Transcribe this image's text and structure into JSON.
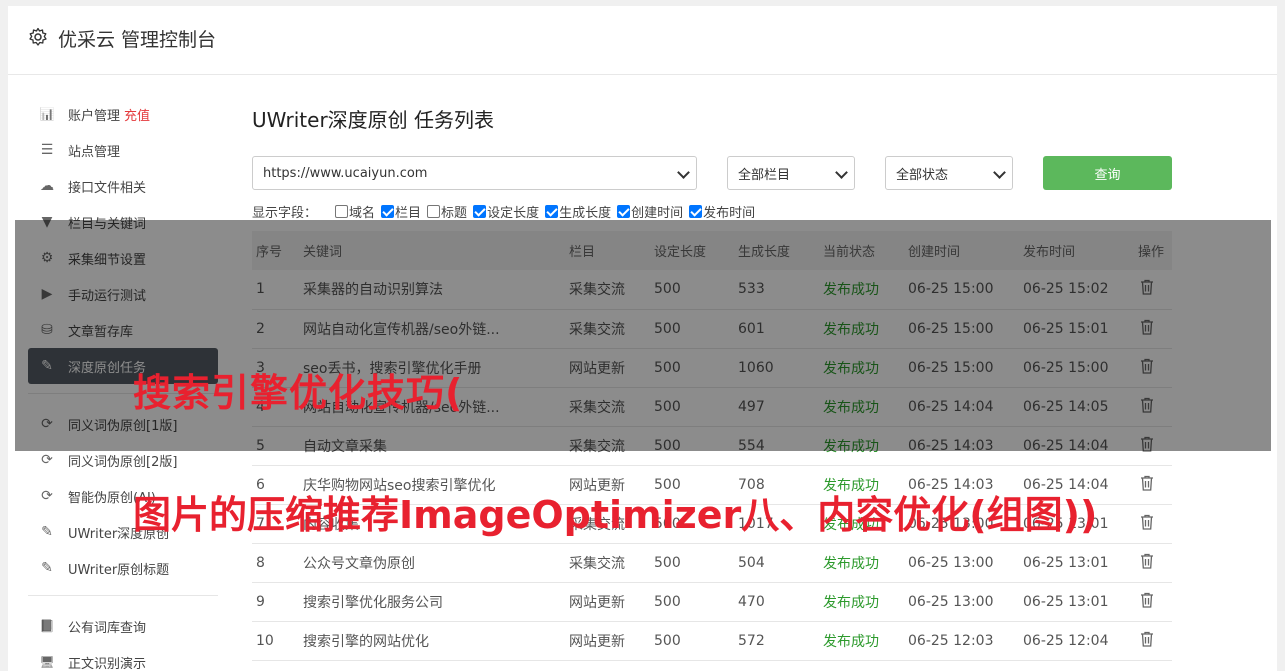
{
  "header": {
    "title": "优采云 管理控制台",
    "icon": "gear-icon"
  },
  "sidebar": {
    "charge_label": "充值",
    "group1": [
      {
        "label": "账户管理",
        "icon": "bar-chart-icon"
      },
      {
        "label": "站点管理",
        "icon": "server-icon"
      },
      {
        "label": "接口文件相关",
        "icon": "cloud-upload-icon"
      },
      {
        "label": "栏目与关键词",
        "icon": "filter-icon"
      },
      {
        "label": "采集细节设置",
        "icon": "cogs-icon"
      },
      {
        "label": "手动运行测试",
        "icon": "play-icon"
      },
      {
        "label": "文章暂存库",
        "icon": "database-icon"
      },
      {
        "label": "深度原创任务",
        "icon": "edit-icon",
        "active": true
      }
    ],
    "group2": [
      {
        "label": "同义词伪原创[1版]",
        "icon": "refresh-icon"
      },
      {
        "label": "同义词伪原创[2版]",
        "icon": "refresh-icon"
      },
      {
        "label": "智能伪原创(AI)",
        "icon": "refresh-icon"
      },
      {
        "label": "UWriter深度原创",
        "icon": "edit-icon"
      },
      {
        "label": "UWriter原创标题",
        "icon": "edit-icon"
      }
    ],
    "group3": [
      {
        "label": "公有词库查询",
        "icon": "book-icon"
      },
      {
        "label": "正文识别演示",
        "icon": "monitor-icon"
      }
    ]
  },
  "main": {
    "title": "UWriter深度原创 任务列表",
    "site_select": "https://www.ucaiyun.com",
    "column_select": "全部栏目",
    "status_select": "全部状态",
    "query_button": "查询",
    "fields_label": "显示字段：",
    "fields": [
      {
        "label": "域名",
        "checked": false
      },
      {
        "label": "栏目",
        "checked": true
      },
      {
        "label": "标题",
        "checked": false
      },
      {
        "label": "设定长度",
        "checked": true
      },
      {
        "label": "生成长度",
        "checked": true
      },
      {
        "label": "创建时间",
        "checked": true
      },
      {
        "label": "发布时间",
        "checked": true
      }
    ],
    "columns": [
      "序号",
      "关键词",
      "栏目",
      "设定长度",
      "生成长度",
      "当前状态",
      "创建时间",
      "发布时间",
      "操作"
    ],
    "rows": [
      [
        "1",
        "采集器的自动识别算法",
        "采集交流",
        "500",
        "533",
        "发布成功",
        "06-25 15:00",
        "06-25 15:02"
      ],
      [
        "2",
        "网站自动化宣传机器/seo外链...",
        "采集交流",
        "500",
        "601",
        "发布成功",
        "06-25 15:00",
        "06-25 15:01"
      ],
      [
        "3",
        "seo丢书，搜索引擎优化手册",
        "网站更新",
        "500",
        "1060",
        "发布成功",
        "06-25 15:00",
        "06-25 15:00"
      ],
      [
        "4",
        "网站自动化宣传机器/seo外链...",
        "采集交流",
        "500",
        "497",
        "发布成功",
        "06-25 14:04",
        "06-25 14:05"
      ],
      [
        "5",
        "自动文章采集",
        "采集交流",
        "500",
        "554",
        "发布成功",
        "06-25 14:03",
        "06-25 14:04"
      ],
      [
        "6",
        "庆华购物网站seo搜索引擎优化",
        "网站更新",
        "500",
        "708",
        "发布成功",
        "06-25 14:03",
        "06-25 14:04"
      ],
      [
        "7",
        "内容收集",
        "采集交流",
        "500",
        "1017",
        "发布成功",
        "06-25 13:00",
        "06-25 13:01"
      ],
      [
        "8",
        "公众号文章伪原创",
        "采集交流",
        "500",
        "504",
        "发布成功",
        "06-25 13:00",
        "06-25 13:01"
      ],
      [
        "9",
        "搜索引擎优化服务公司",
        "网站更新",
        "500",
        "470",
        "发布成功",
        "06-25 13:00",
        "06-25 13:01"
      ],
      [
        "10",
        "搜索引擎的网站优化",
        "网站更新",
        "500",
        "572",
        "发布成功",
        "06-25 12:03",
        "06-25 12:04"
      ]
    ]
  },
  "watermark": {
    "line1": "搜索引擎优化技巧(",
    "line2": "图片的压缩推荐ImageOptimizer八、内容优化(组图))"
  },
  "colors": {
    "accent_green": "#5cb85c",
    "active_sidebar": "#545c64",
    "charge_red": "#e4393c",
    "status_ok": "#2d9a2d",
    "watermark_red": "#e8212f"
  }
}
